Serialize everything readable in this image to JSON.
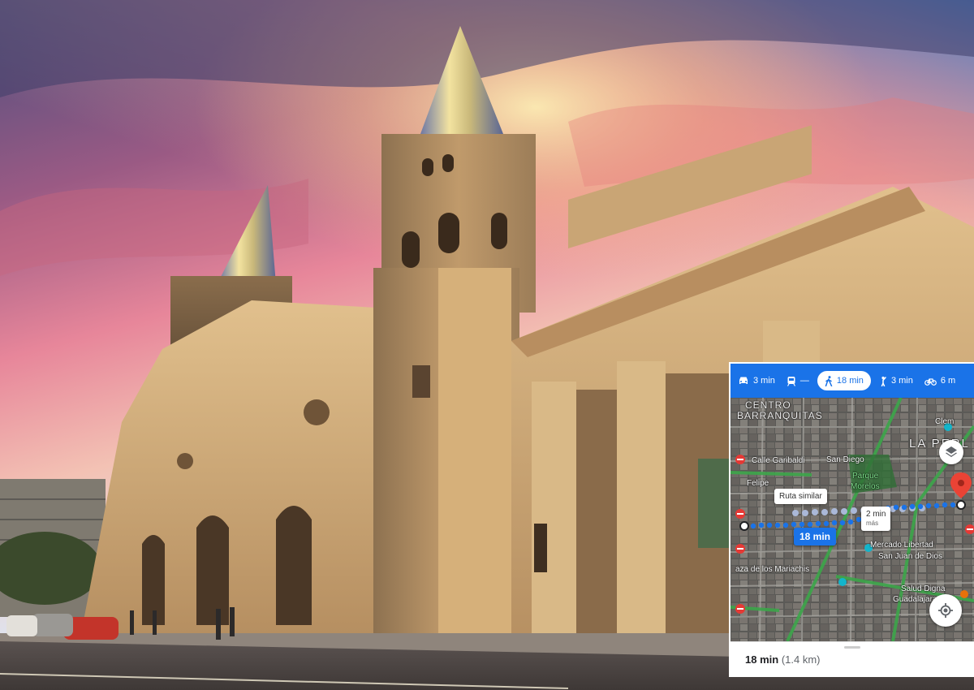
{
  "travel_modes": [
    {
      "mode": "drive",
      "icon": "car-icon",
      "time": "3 min"
    },
    {
      "mode": "transit",
      "icon": "train-icon",
      "time": "—"
    },
    {
      "mode": "walk",
      "icon": "walking-icon",
      "time": "18 min",
      "selected": true
    },
    {
      "mode": "ride-share",
      "icon": "person-hail-icon",
      "time": "3 min"
    },
    {
      "mode": "bike",
      "icon": "bicycle-icon",
      "time": "6 m"
    }
  ],
  "map": {
    "labels": {
      "centro": "CENTRO",
      "barranquitas": "BARRANQUITAS",
      "la_perla": "LA PERL",
      "calle_garibaldi": "Calle Garibaldi",
      "san_diego": "San Diego",
      "clemente": "Clem",
      "parque": "Parque",
      "morelos": "Morelos",
      "san_felipe": "Felipe",
      "mercado": "Mercado Libertad",
      "san_juan": "San Juan de Dios",
      "mariachis": "aza de los Mariachis",
      "salud": "Salud Digna",
      "guadalajara": "Guadalajara Sa"
    },
    "route_callouts": {
      "similar": "Ruta similar",
      "alt_time": "2 min",
      "alt_sub": "más",
      "main_time": "18 min"
    },
    "route_color": "#1a73e8",
    "alt_route_color": "#aab8d8",
    "destination_color": "#ea4335"
  },
  "bottom_sheet": {
    "duration": "18 min",
    "distance": "(1.4 km)"
  }
}
